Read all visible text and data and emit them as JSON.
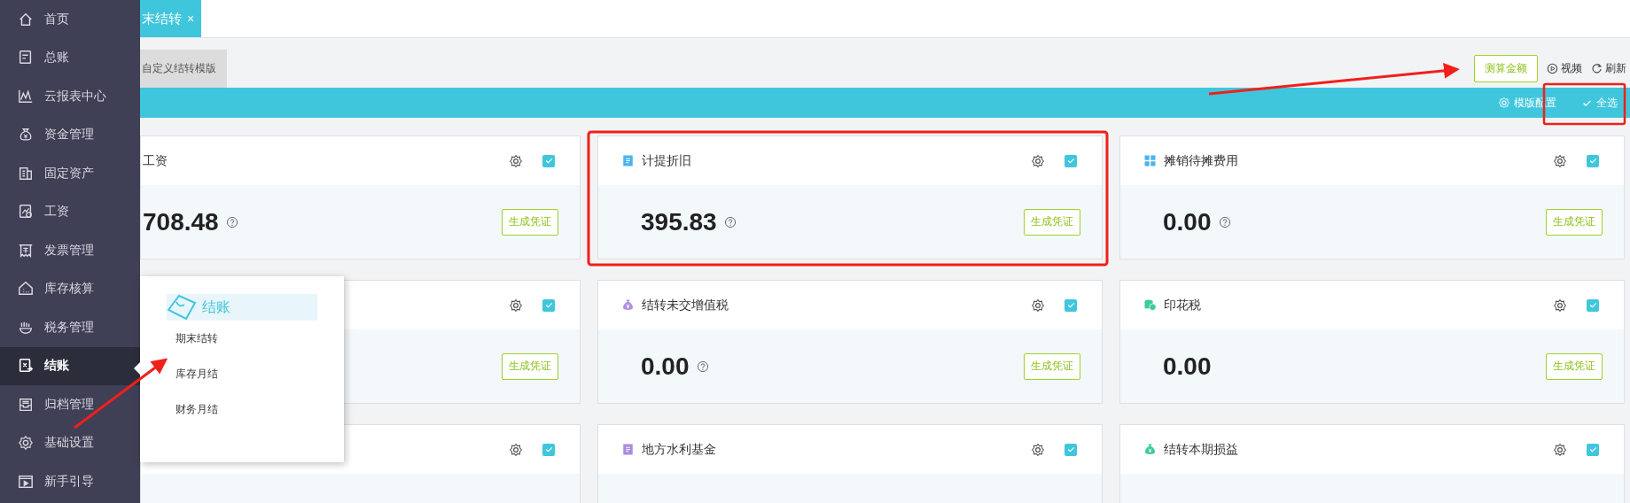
{
  "sidebar": {
    "items": [
      {
        "label": "首页",
        "kind": "home",
        "selected": false
      },
      {
        "label": "总账",
        "kind": "ledger",
        "selected": false
      },
      {
        "label": "云报表中心",
        "kind": "chart",
        "selected": false
      },
      {
        "label": "资金管理",
        "kind": "bag",
        "selected": false
      },
      {
        "label": "固定资产",
        "kind": "building",
        "selected": false
      },
      {
        "label": "工资",
        "kind": "payroll",
        "selected": false
      },
      {
        "label": "发票管理",
        "kind": "invoice",
        "selected": false
      },
      {
        "label": "库存核算",
        "kind": "warehouse",
        "selected": false
      },
      {
        "label": "税务管理",
        "kind": "tax",
        "selected": false
      },
      {
        "label": "结账",
        "kind": "checkout",
        "selected": true
      },
      {
        "label": "归档管理",
        "kind": "archive",
        "selected": false
      },
      {
        "label": "基础设置",
        "kind": "gear",
        "selected": false
      },
      {
        "label": "新手引导",
        "kind": "play",
        "selected": false
      }
    ]
  },
  "page_tabs": [
    {
      "label": "末结转",
      "close": "×",
      "selected": true
    }
  ],
  "sub_tabs": [
    {
      "label": "自定义结转模版",
      "selected": false
    }
  ],
  "actions": {
    "calculate": "测算金额",
    "video": "视频",
    "refresh": "刷新"
  },
  "bar": {
    "template_config": "模版配置",
    "select_all": "全选"
  },
  "cards": [
    {
      "title": "工资",
      "amount": "708.48",
      "help": true,
      "checked": true,
      "button": "生成凭证"
    },
    {
      "title": "计提折旧",
      "kind": "doc",
      "color": "#4ab3ee",
      "amount": "395.83",
      "help": true,
      "checked": true,
      "button": "生成凭证"
    },
    {
      "title": "摊销待摊费用",
      "kind": "grid",
      "color": "#4db2ec",
      "amount": "0.00",
      "help": true,
      "checked": true,
      "button": "生成凭证"
    },
    {
      "checked": true,
      "button": "生成凭证"
    },
    {
      "title": "结转未交增值税",
      "kind": "purse",
      "color": "#b18fe0",
      "amount": "0.00",
      "help": true,
      "checked": true,
      "button": "生成凭证"
    },
    {
      "title": "印花税",
      "kind": "coins",
      "color": "#3ccb9c",
      "amount": "0.00",
      "help": false,
      "checked": true,
      "button": "生成凭证"
    },
    {
      "checked": true
    },
    {
      "title": "地方水利基金",
      "kind": "doc",
      "color": "#a98be0",
      "checked": true
    },
    {
      "title": "结转本期损益",
      "kind": "purse",
      "color": "#3ccb9c",
      "checked": true
    }
  ],
  "popup": {
    "title": "结账",
    "items": [
      "期末结转",
      "库存月结",
      "财务月结"
    ]
  }
}
